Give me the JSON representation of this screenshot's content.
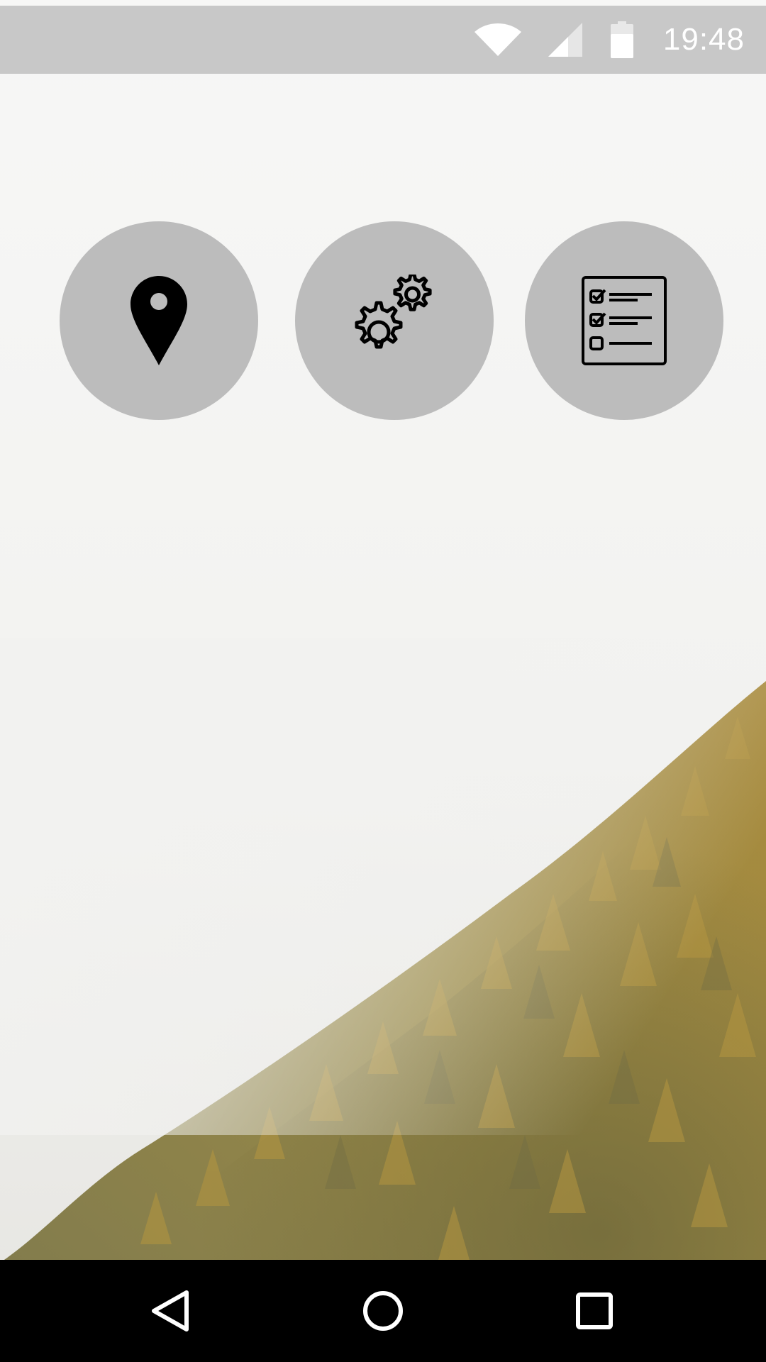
{
  "status_bar": {
    "time": "19:48",
    "icons": [
      "wifi-icon",
      "cell-signal-icon",
      "battery-icon"
    ],
    "background": "#c8c8c8",
    "text_color": "#ffffff"
  },
  "home_screen": {
    "wallpaper": "foggy-forest-wallpaper",
    "apps": [
      {
        "icon": "location-pin-icon"
      },
      {
        "icon": "gears-icon"
      },
      {
        "icon": "checklist-icon"
      }
    ],
    "circle_color": "#bcbcbc"
  },
  "nav_bar": {
    "buttons": [
      "back-triangle-icon",
      "home-circle-icon",
      "recents-square-icon"
    ],
    "background": "#000000",
    "icon_color": "#ffffff"
  }
}
